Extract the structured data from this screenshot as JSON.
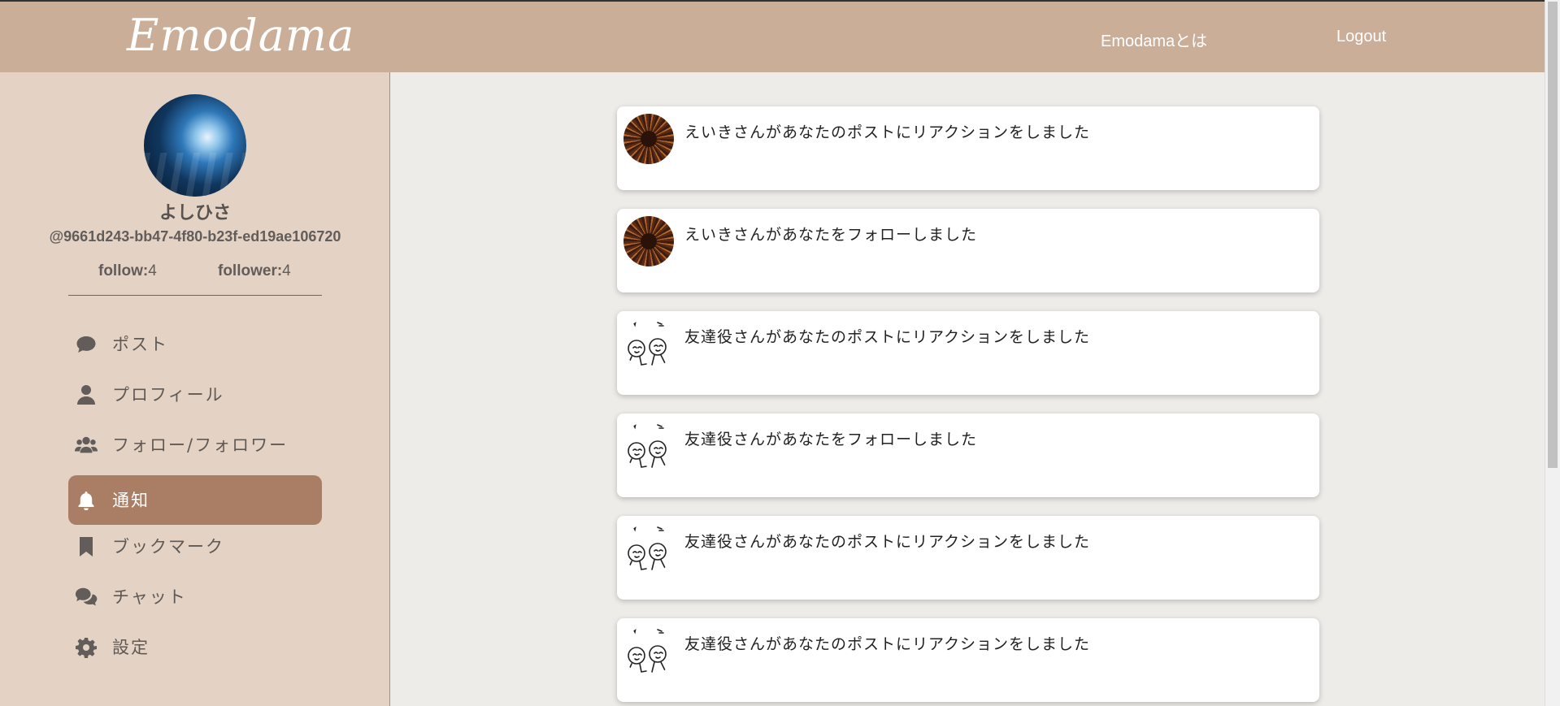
{
  "header": {
    "logo": "Emodama",
    "nav": [
      {
        "label": "Emodamaとは"
      },
      {
        "label": "Logout"
      }
    ]
  },
  "profile": {
    "display_name": "よしひさ",
    "handle": "@9661d243-bb47-4f80-b23f-ed19ae106720",
    "follow_label": "follow:",
    "follow_count": "4",
    "follower_label": "follower:",
    "follower_count": "4"
  },
  "menu": [
    {
      "label": "ポスト",
      "icon": "comment-icon",
      "active": false
    },
    {
      "label": "プロフィール",
      "icon": "user-icon",
      "active": false
    },
    {
      "label": "フォロー/フォロワー",
      "icon": "users-icon",
      "active": false
    },
    {
      "label": "通知",
      "icon": "bell-icon",
      "active": true
    },
    {
      "label": "ブックマーク",
      "icon": "bookmark-icon",
      "active": false
    },
    {
      "label": "チャット",
      "icon": "chat-icon",
      "active": false
    },
    {
      "label": "設定",
      "icon": "gear-icon",
      "active": false
    }
  ],
  "notifications": [
    {
      "text": "えいきさんがあなたのポストにリアクションをしました",
      "avatar": "dark"
    },
    {
      "text": "えいきさんがあなたをフォローしました",
      "avatar": "dark"
    },
    {
      "text": "友達役さんがあなたのポストにリアクションをしました",
      "avatar": "sketch"
    },
    {
      "text": "友達役さんがあなたをフォローしました",
      "avatar": "sketch"
    },
    {
      "text": "友達役さんがあなたのポストにリアクションをしました",
      "avatar": "sketch"
    },
    {
      "text": "友達役さんがあなたのポストにリアクションをしました",
      "avatar": "sketch"
    }
  ],
  "colors": {
    "header": "#cbae98",
    "sidebar": "#e4d3c5",
    "active_menu": "#aa7e65",
    "content_bg": "#eeece9"
  }
}
